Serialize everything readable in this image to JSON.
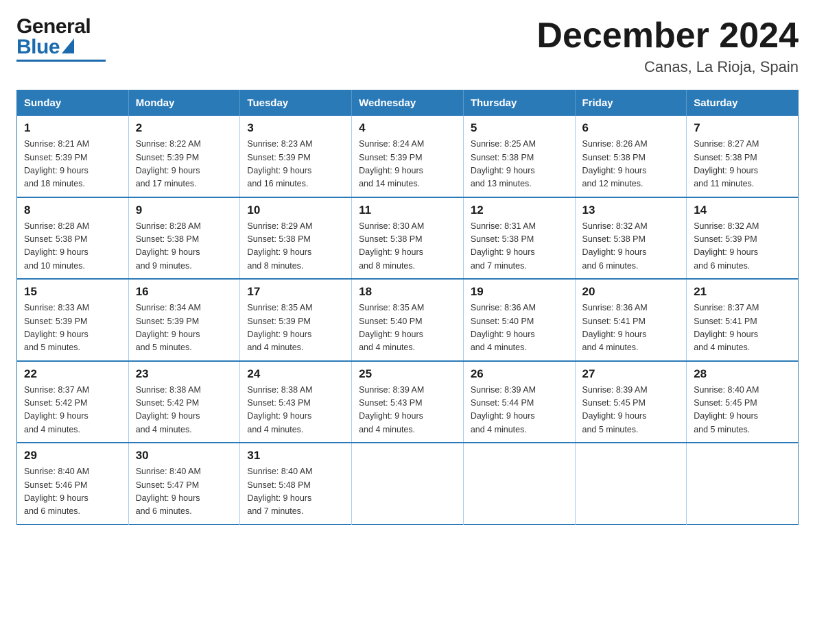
{
  "header": {
    "title": "December 2024",
    "subtitle": "Canas, La Rioja, Spain",
    "logo_general": "General",
    "logo_blue": "Blue"
  },
  "calendar": {
    "days_of_week": [
      "Sunday",
      "Monday",
      "Tuesday",
      "Wednesday",
      "Thursday",
      "Friday",
      "Saturday"
    ],
    "weeks": [
      [
        {
          "day": "1",
          "sunrise": "8:21 AM",
          "sunset": "5:39 PM",
          "daylight": "9 hours and 18 minutes."
        },
        {
          "day": "2",
          "sunrise": "8:22 AM",
          "sunset": "5:39 PM",
          "daylight": "9 hours and 17 minutes."
        },
        {
          "day": "3",
          "sunrise": "8:23 AM",
          "sunset": "5:39 PM",
          "daylight": "9 hours and 16 minutes."
        },
        {
          "day": "4",
          "sunrise": "8:24 AM",
          "sunset": "5:39 PM",
          "daylight": "9 hours and 14 minutes."
        },
        {
          "day": "5",
          "sunrise": "8:25 AM",
          "sunset": "5:38 PM",
          "daylight": "9 hours and 13 minutes."
        },
        {
          "day": "6",
          "sunrise": "8:26 AM",
          "sunset": "5:38 PM",
          "daylight": "9 hours and 12 minutes."
        },
        {
          "day": "7",
          "sunrise": "8:27 AM",
          "sunset": "5:38 PM",
          "daylight": "9 hours and 11 minutes."
        }
      ],
      [
        {
          "day": "8",
          "sunrise": "8:28 AM",
          "sunset": "5:38 PM",
          "daylight": "9 hours and 10 minutes."
        },
        {
          "day": "9",
          "sunrise": "8:28 AM",
          "sunset": "5:38 PM",
          "daylight": "9 hours and 9 minutes."
        },
        {
          "day": "10",
          "sunrise": "8:29 AM",
          "sunset": "5:38 PM",
          "daylight": "9 hours and 8 minutes."
        },
        {
          "day": "11",
          "sunrise": "8:30 AM",
          "sunset": "5:38 PM",
          "daylight": "9 hours and 8 minutes."
        },
        {
          "day": "12",
          "sunrise": "8:31 AM",
          "sunset": "5:38 PM",
          "daylight": "9 hours and 7 minutes."
        },
        {
          "day": "13",
          "sunrise": "8:32 AM",
          "sunset": "5:38 PM",
          "daylight": "9 hours and 6 minutes."
        },
        {
          "day": "14",
          "sunrise": "8:32 AM",
          "sunset": "5:39 PM",
          "daylight": "9 hours and 6 minutes."
        }
      ],
      [
        {
          "day": "15",
          "sunrise": "8:33 AM",
          "sunset": "5:39 PM",
          "daylight": "9 hours and 5 minutes."
        },
        {
          "day": "16",
          "sunrise": "8:34 AM",
          "sunset": "5:39 PM",
          "daylight": "9 hours and 5 minutes."
        },
        {
          "day": "17",
          "sunrise": "8:35 AM",
          "sunset": "5:39 PM",
          "daylight": "9 hours and 4 minutes."
        },
        {
          "day": "18",
          "sunrise": "8:35 AM",
          "sunset": "5:40 PM",
          "daylight": "9 hours and 4 minutes."
        },
        {
          "day": "19",
          "sunrise": "8:36 AM",
          "sunset": "5:40 PM",
          "daylight": "9 hours and 4 minutes."
        },
        {
          "day": "20",
          "sunrise": "8:36 AM",
          "sunset": "5:41 PM",
          "daylight": "9 hours and 4 minutes."
        },
        {
          "day": "21",
          "sunrise": "8:37 AM",
          "sunset": "5:41 PM",
          "daylight": "9 hours and 4 minutes."
        }
      ],
      [
        {
          "day": "22",
          "sunrise": "8:37 AM",
          "sunset": "5:42 PM",
          "daylight": "9 hours and 4 minutes."
        },
        {
          "day": "23",
          "sunrise": "8:38 AM",
          "sunset": "5:42 PM",
          "daylight": "9 hours and 4 minutes."
        },
        {
          "day": "24",
          "sunrise": "8:38 AM",
          "sunset": "5:43 PM",
          "daylight": "9 hours and 4 minutes."
        },
        {
          "day": "25",
          "sunrise": "8:39 AM",
          "sunset": "5:43 PM",
          "daylight": "9 hours and 4 minutes."
        },
        {
          "day": "26",
          "sunrise": "8:39 AM",
          "sunset": "5:44 PM",
          "daylight": "9 hours and 4 minutes."
        },
        {
          "day": "27",
          "sunrise": "8:39 AM",
          "sunset": "5:45 PM",
          "daylight": "9 hours and 5 minutes."
        },
        {
          "day": "28",
          "sunrise": "8:40 AM",
          "sunset": "5:45 PM",
          "daylight": "9 hours and 5 minutes."
        }
      ],
      [
        {
          "day": "29",
          "sunrise": "8:40 AM",
          "sunset": "5:46 PM",
          "daylight": "9 hours and 6 minutes."
        },
        {
          "day": "30",
          "sunrise": "8:40 AM",
          "sunset": "5:47 PM",
          "daylight": "9 hours and 6 minutes."
        },
        {
          "day": "31",
          "sunrise": "8:40 AM",
          "sunset": "5:48 PM",
          "daylight": "9 hours and 7 minutes."
        },
        null,
        null,
        null,
        null
      ]
    ],
    "labels": {
      "sunrise": "Sunrise:",
      "sunset": "Sunset:",
      "daylight": "Daylight:"
    }
  }
}
